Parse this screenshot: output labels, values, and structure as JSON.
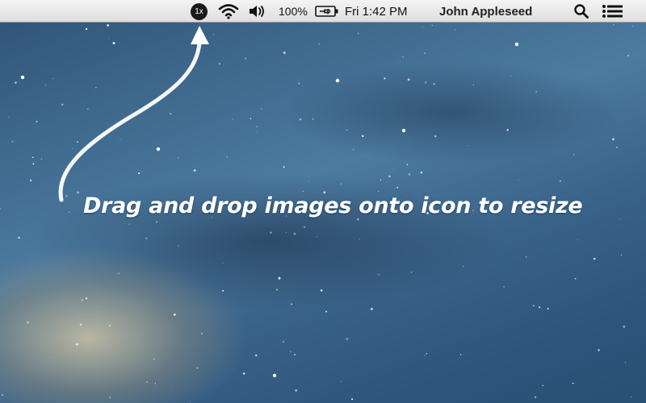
{
  "menubar": {
    "app_icon_label": "1x",
    "app_icon_icon": "app-resize-icon",
    "wifi_icon": "wifi-icon",
    "volume_icon": "speaker-volume-icon",
    "battery_percent": "100%",
    "battery_icon": "battery-charging-icon",
    "clock": "Fri 1:42 PM",
    "user_name": "John Appleseed",
    "spotlight_icon": "search-icon",
    "notification_icon": "list-icon"
  },
  "desktop": {
    "caption": "Drag and drop images onto icon to resize",
    "arrow_icon": "curved-arrow-icon"
  }
}
